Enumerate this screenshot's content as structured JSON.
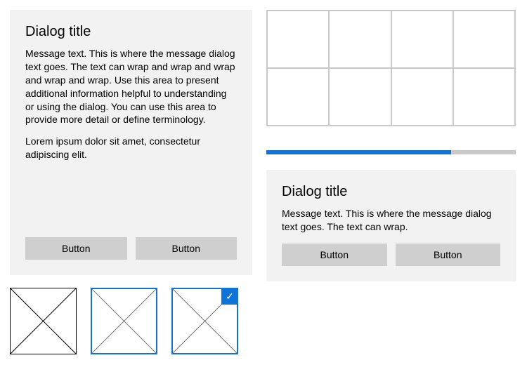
{
  "dialog_large": {
    "title": "Dialog title",
    "body_p1": "Message text. This is where the message dialog text goes. The text can wrap and wrap and wrap and wrap and wrap. Use this area to present additional information helpful to understanding or using the dialog. You can use this area to provide more detail or define terminology.",
    "body_p2": "Lorem ipsum dolor sit amet, consectetur adipiscing elit.",
    "button1": "Button",
    "button2": "Button"
  },
  "dialog_small": {
    "title": "Dialog title",
    "body": "Message text. This is where the message dialog text goes. The text can wrap.",
    "button1": "Button",
    "button2": "Button"
  },
  "thumbnails": {
    "state1": "default",
    "state2": "selected",
    "state3": "checked"
  },
  "progress": {
    "percent": 74
  },
  "colors": {
    "accent": "#1073d6",
    "panel": "#f2f2f2",
    "button": "#cfcfcf",
    "grid_border": "#c9c9c9"
  }
}
